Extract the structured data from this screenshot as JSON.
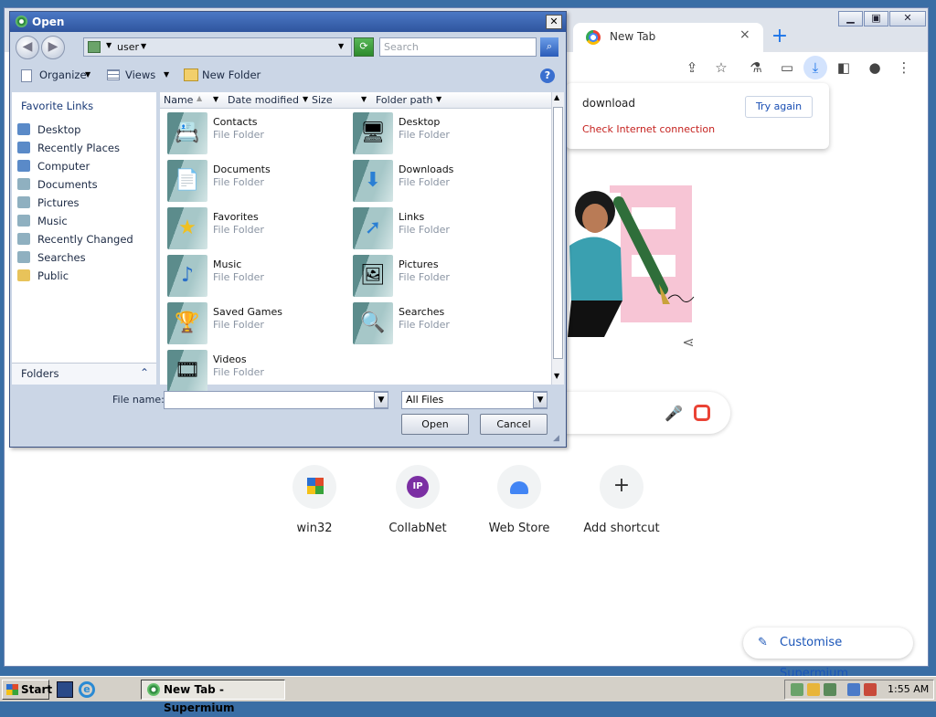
{
  "browser": {
    "tab_title": "New Tab",
    "tab_close": "×",
    "new_tab": "+",
    "window_controls": {
      "minimize": "▁",
      "restore": "▣",
      "close": "✕"
    },
    "toolbar_icons": [
      "share-icon",
      "star-icon",
      "extensions-icon",
      "cast-icon",
      "download-icon",
      "sidebar-icon",
      "profile-icon",
      "menu-icon"
    ],
    "download_popup": {
      "name": "download",
      "error": "Check Internet connection",
      "retry": "Try again"
    },
    "shortcuts": [
      {
        "label": "win32"
      },
      {
        "label": "CollabNet"
      },
      {
        "label": "Web Store"
      },
      {
        "label": "Add shortcut"
      }
    ],
    "customise": "Customise Supermium"
  },
  "dialog": {
    "title": "Open",
    "close": "✕",
    "address": {
      "folder": "user"
    },
    "search_placeholder": "Search",
    "commands": {
      "organize": "Organize",
      "views": "Views",
      "new_folder": "New Folder"
    },
    "favorite_links_heading": "Favorite Links",
    "favorite_links": [
      "Desktop",
      "Recently Places",
      "Computer",
      "Documents",
      "Pictures",
      "Music",
      "Recently Changed",
      "Searches",
      "Public"
    ],
    "folders_label": "Folders",
    "columns": [
      "Name",
      "Date modified",
      "Size",
      "Folder path"
    ],
    "files": [
      {
        "name": "Contacts",
        "type": "File Folder",
        "icon": "📇"
      },
      {
        "name": "Desktop",
        "type": "File Folder",
        "icon": "🖥"
      },
      {
        "name": "Documents",
        "type": "File Folder",
        "icon": "📄"
      },
      {
        "name": "Downloads",
        "type": "File Folder",
        "icon": "⬇"
      },
      {
        "name": "Favorites",
        "type": "File Folder",
        "icon": "★"
      },
      {
        "name": "Links",
        "type": "File Folder",
        "icon": "➚"
      },
      {
        "name": "Music",
        "type": "File Folder",
        "icon": "♪"
      },
      {
        "name": "Pictures",
        "type": "File Folder",
        "icon": "🖼"
      },
      {
        "name": "Saved Games",
        "type": "File Folder",
        "icon": "🏆"
      },
      {
        "name": "Searches",
        "type": "File Folder",
        "icon": "🔍"
      },
      {
        "name": "Videos",
        "type": "File Folder",
        "icon": "🎞"
      }
    ],
    "file_name_label": "File name:",
    "file_name_value": "",
    "file_type": "All Files",
    "open_button": "Open",
    "cancel_button": "Cancel"
  },
  "taskbar": {
    "start": "Start",
    "task": "New Tab - Supermium",
    "clock": "1:55 AM"
  }
}
